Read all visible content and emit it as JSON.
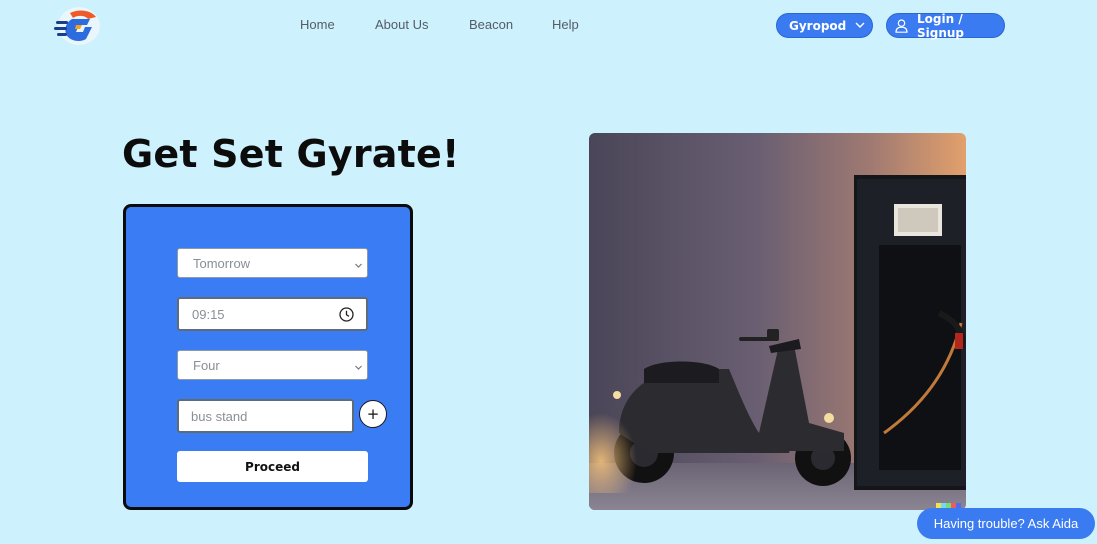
{
  "brand": {
    "logo": "gyrate-logo"
  },
  "nav": {
    "items": [
      {
        "label": "Home"
      },
      {
        "label": "About Us"
      },
      {
        "label": "Beacon"
      },
      {
        "label": "Help"
      }
    ]
  },
  "header": {
    "product_dropdown_label": "Gyropod",
    "login_label": "Login / Signup",
    "icons": {
      "dropdown": "chevron-down-icon",
      "login": "user-icon"
    }
  },
  "hero": {
    "title": "Get Set Gyrate!"
  },
  "booking_form": {
    "day_select": {
      "value": "Tomorrow"
    },
    "time_input": {
      "value": "09:15",
      "icon": "clock-icon"
    },
    "count_select": {
      "value": "Four"
    },
    "location_input": {
      "placeholder": "bus stand",
      "add_icon": "plus-icon"
    },
    "submit_label": "Proceed"
  },
  "image": {
    "subject": "scooter-charging-station"
  },
  "help_chat": {
    "label": "Having trouble? Ask Aida"
  },
  "colors": {
    "page_bg": "#cdf1fd",
    "accent": "#3a7bf1",
    "form_bg": "#3a7cf4"
  }
}
